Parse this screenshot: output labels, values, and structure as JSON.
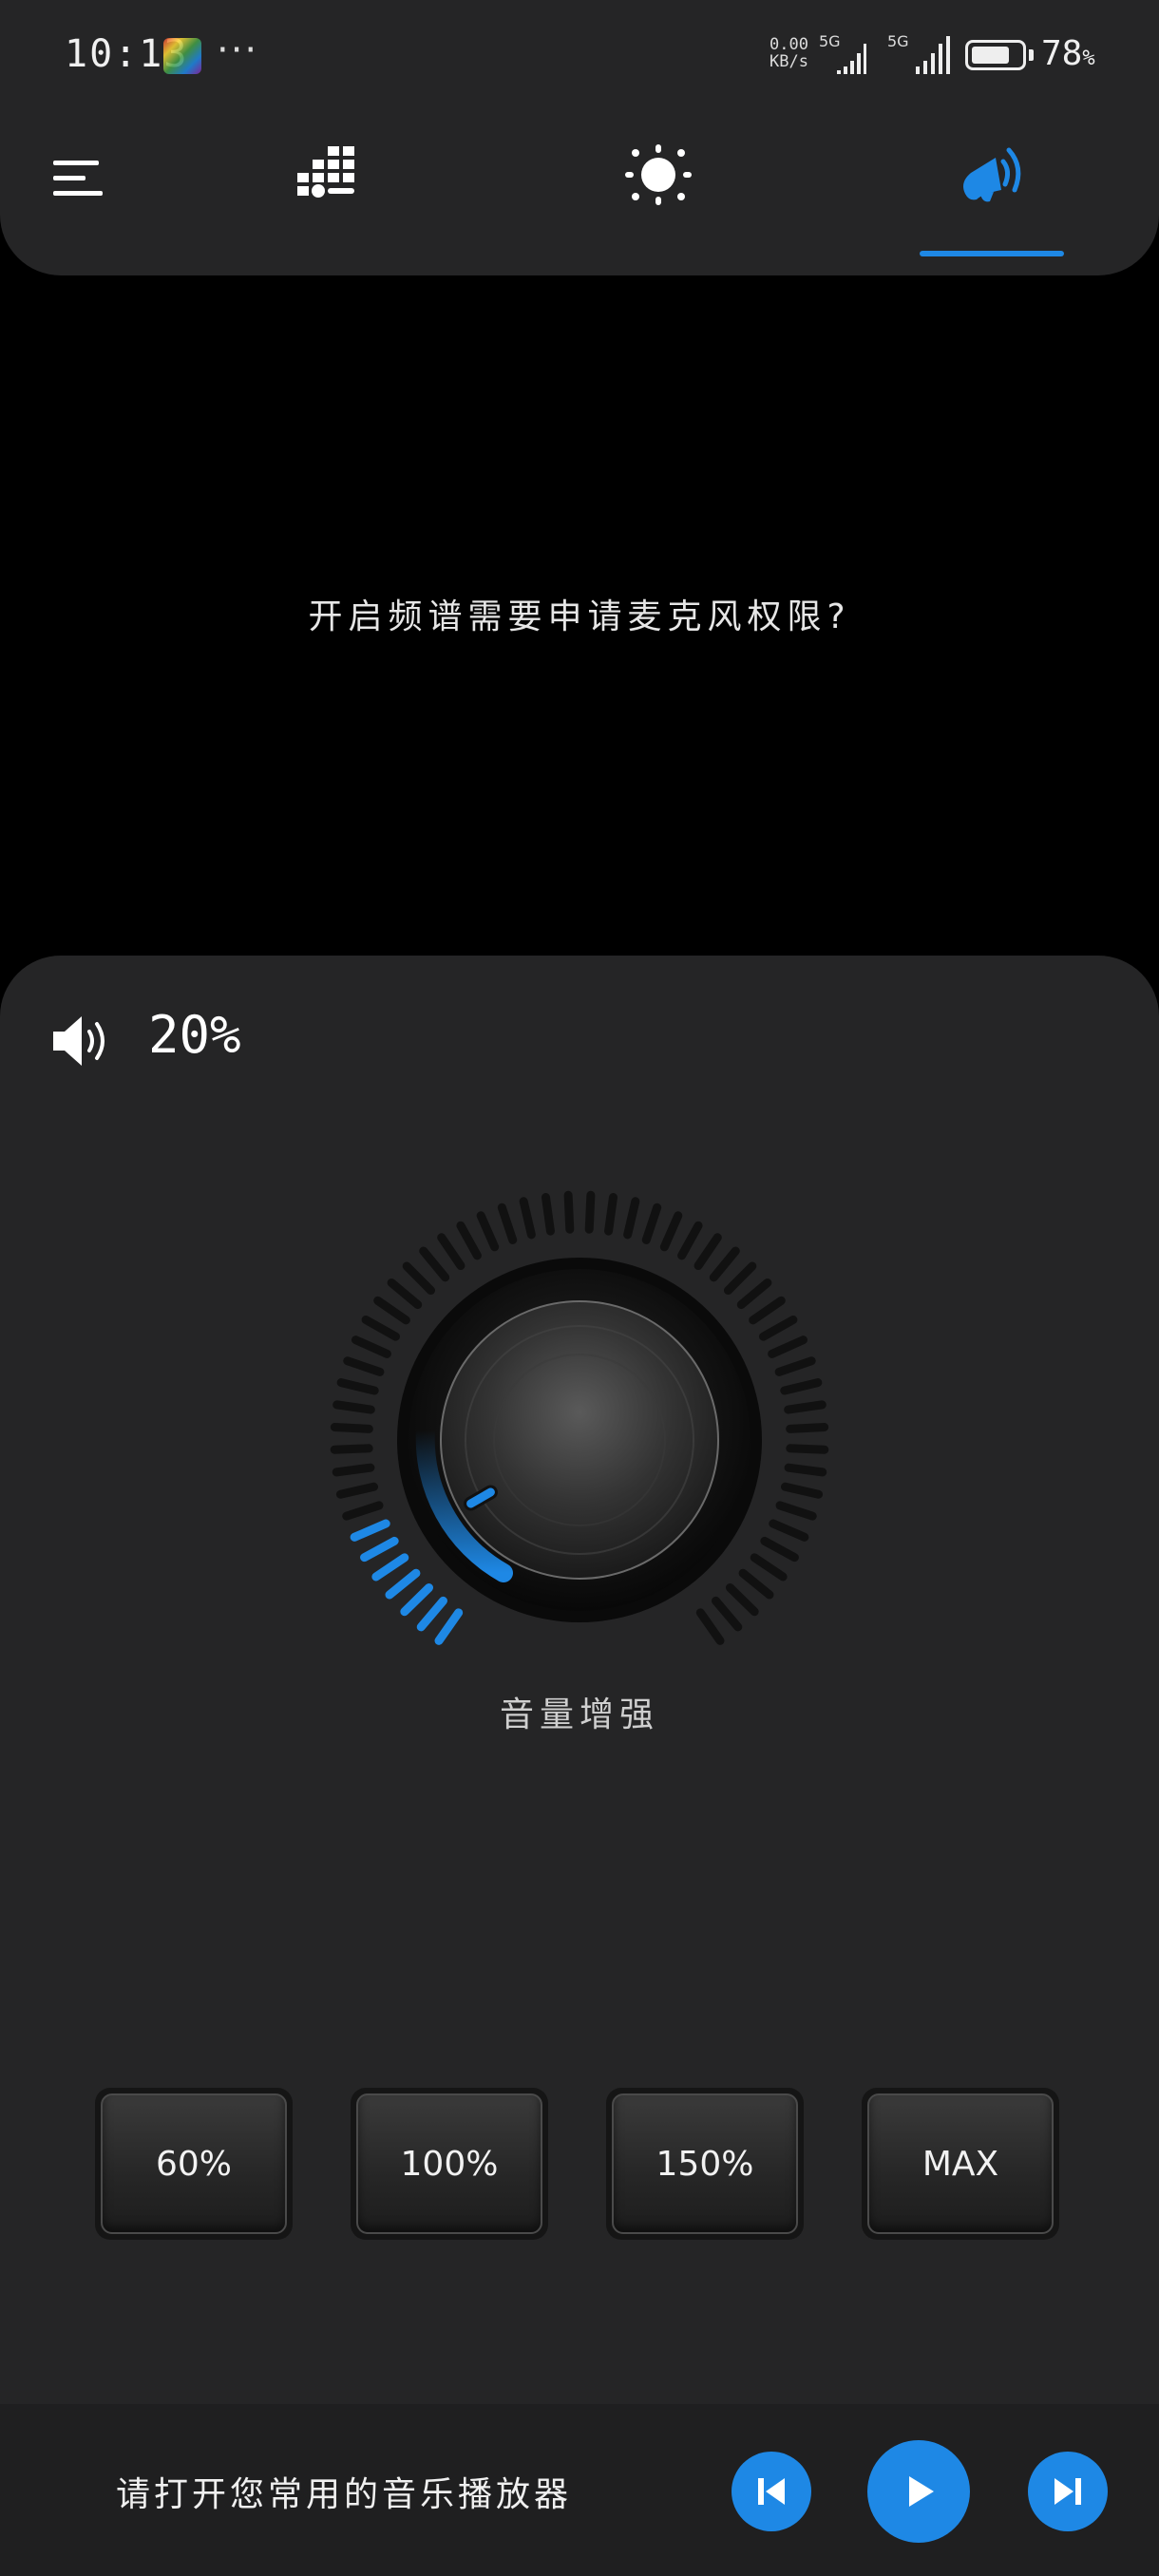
{
  "status_bar": {
    "time": "10:13",
    "more": "···",
    "net_speed_value": "0.00",
    "net_speed_unit": "KB/s",
    "sim1_label": "5G",
    "sim2_label": "5G",
    "battery_percent": "78",
    "battery_symbol": "%",
    "battery_level": 0.78
  },
  "tabs": [
    {
      "name": "menu",
      "icon": "menu-icon"
    },
    {
      "name": "equalizer",
      "icon": "equalizer-icon"
    },
    {
      "name": "light",
      "icon": "sun-icon"
    },
    {
      "name": "volume-boost",
      "icon": "speaker-icon",
      "active": true
    }
  ],
  "colors": {
    "accent": "#1e88e5",
    "panel": "#252526",
    "background": "#000000"
  },
  "permission_prompt": "开启频谱需要申请麦克风权限?",
  "volume": {
    "percent_label": "20%",
    "level": 0.2
  },
  "knob": {
    "label": "音量增强",
    "active_ticks": 7,
    "total_ticks": 56
  },
  "presets": [
    "60%",
    "100%",
    "150%",
    "MAX"
  ],
  "player": {
    "prompt": "请打开您常用的音乐播放器",
    "buttons": [
      "previous-icon",
      "play-icon",
      "next-icon"
    ]
  }
}
